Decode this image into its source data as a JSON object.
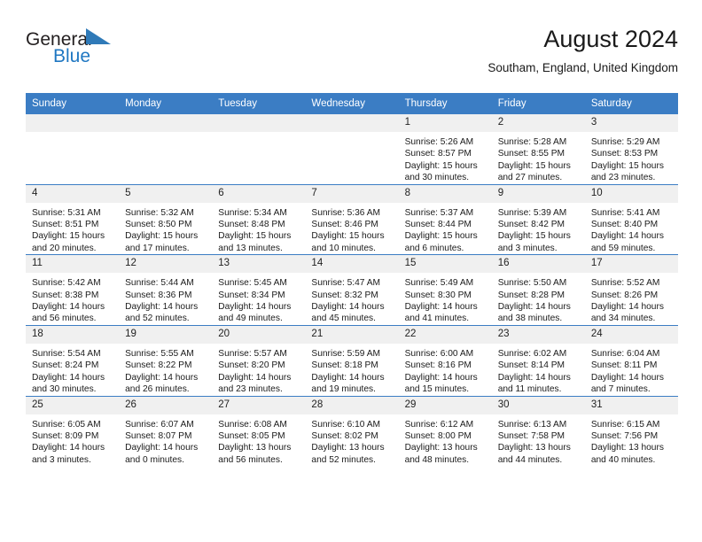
{
  "brand": {
    "name_part1": "General",
    "name_part2": "Blue",
    "triangle_color": "#2f7ab8",
    "text_color": "#231f20",
    "blue_color": "#1f77c2"
  },
  "header": {
    "title": "August 2024",
    "subtitle": "Southam, England, United Kingdom"
  },
  "theme": {
    "header_bg": "#3b7dc4",
    "header_text": "#ffffff",
    "daynum_bg": "#f0f0f0",
    "row_divider": "#3b7dc4",
    "body_text": "#1a1a1a"
  },
  "weekdays": [
    "Sunday",
    "Monday",
    "Tuesday",
    "Wednesday",
    "Thursday",
    "Friday",
    "Saturday"
  ],
  "labels": {
    "sunrise": "Sunrise:",
    "sunset": "Sunset:",
    "daylight": "Daylight:"
  },
  "weeks": [
    [
      {
        "day": "",
        "sunrise": "",
        "sunset": "",
        "daylight": ""
      },
      {
        "day": "",
        "sunrise": "",
        "sunset": "",
        "daylight": ""
      },
      {
        "day": "",
        "sunrise": "",
        "sunset": "",
        "daylight": ""
      },
      {
        "day": "",
        "sunrise": "",
        "sunset": "",
        "daylight": ""
      },
      {
        "day": "1",
        "sunrise": "Sunrise: 5:26 AM",
        "sunset": "Sunset: 8:57 PM",
        "daylight": "Daylight: 15 hours and 30 minutes."
      },
      {
        "day": "2",
        "sunrise": "Sunrise: 5:28 AM",
        "sunset": "Sunset: 8:55 PM",
        "daylight": "Daylight: 15 hours and 27 minutes."
      },
      {
        "day": "3",
        "sunrise": "Sunrise: 5:29 AM",
        "sunset": "Sunset: 8:53 PM",
        "daylight": "Daylight: 15 hours and 23 minutes."
      }
    ],
    [
      {
        "day": "4",
        "sunrise": "Sunrise: 5:31 AM",
        "sunset": "Sunset: 8:51 PM",
        "daylight": "Daylight: 15 hours and 20 minutes."
      },
      {
        "day": "5",
        "sunrise": "Sunrise: 5:32 AM",
        "sunset": "Sunset: 8:50 PM",
        "daylight": "Daylight: 15 hours and 17 minutes."
      },
      {
        "day": "6",
        "sunrise": "Sunrise: 5:34 AM",
        "sunset": "Sunset: 8:48 PM",
        "daylight": "Daylight: 15 hours and 13 minutes."
      },
      {
        "day": "7",
        "sunrise": "Sunrise: 5:36 AM",
        "sunset": "Sunset: 8:46 PM",
        "daylight": "Daylight: 15 hours and 10 minutes."
      },
      {
        "day": "8",
        "sunrise": "Sunrise: 5:37 AM",
        "sunset": "Sunset: 8:44 PM",
        "daylight": "Daylight: 15 hours and 6 minutes."
      },
      {
        "day": "9",
        "sunrise": "Sunrise: 5:39 AM",
        "sunset": "Sunset: 8:42 PM",
        "daylight": "Daylight: 15 hours and 3 minutes."
      },
      {
        "day": "10",
        "sunrise": "Sunrise: 5:41 AM",
        "sunset": "Sunset: 8:40 PM",
        "daylight": "Daylight: 14 hours and 59 minutes."
      }
    ],
    [
      {
        "day": "11",
        "sunrise": "Sunrise: 5:42 AM",
        "sunset": "Sunset: 8:38 PM",
        "daylight": "Daylight: 14 hours and 56 minutes."
      },
      {
        "day": "12",
        "sunrise": "Sunrise: 5:44 AM",
        "sunset": "Sunset: 8:36 PM",
        "daylight": "Daylight: 14 hours and 52 minutes."
      },
      {
        "day": "13",
        "sunrise": "Sunrise: 5:45 AM",
        "sunset": "Sunset: 8:34 PM",
        "daylight": "Daylight: 14 hours and 49 minutes."
      },
      {
        "day": "14",
        "sunrise": "Sunrise: 5:47 AM",
        "sunset": "Sunset: 8:32 PM",
        "daylight": "Daylight: 14 hours and 45 minutes."
      },
      {
        "day": "15",
        "sunrise": "Sunrise: 5:49 AM",
        "sunset": "Sunset: 8:30 PM",
        "daylight": "Daylight: 14 hours and 41 minutes."
      },
      {
        "day": "16",
        "sunrise": "Sunrise: 5:50 AM",
        "sunset": "Sunset: 8:28 PM",
        "daylight": "Daylight: 14 hours and 38 minutes."
      },
      {
        "day": "17",
        "sunrise": "Sunrise: 5:52 AM",
        "sunset": "Sunset: 8:26 PM",
        "daylight": "Daylight: 14 hours and 34 minutes."
      }
    ],
    [
      {
        "day": "18",
        "sunrise": "Sunrise: 5:54 AM",
        "sunset": "Sunset: 8:24 PM",
        "daylight": "Daylight: 14 hours and 30 minutes."
      },
      {
        "day": "19",
        "sunrise": "Sunrise: 5:55 AM",
        "sunset": "Sunset: 8:22 PM",
        "daylight": "Daylight: 14 hours and 26 minutes."
      },
      {
        "day": "20",
        "sunrise": "Sunrise: 5:57 AM",
        "sunset": "Sunset: 8:20 PM",
        "daylight": "Daylight: 14 hours and 23 minutes."
      },
      {
        "day": "21",
        "sunrise": "Sunrise: 5:59 AM",
        "sunset": "Sunset: 8:18 PM",
        "daylight": "Daylight: 14 hours and 19 minutes."
      },
      {
        "day": "22",
        "sunrise": "Sunrise: 6:00 AM",
        "sunset": "Sunset: 8:16 PM",
        "daylight": "Daylight: 14 hours and 15 minutes."
      },
      {
        "day": "23",
        "sunrise": "Sunrise: 6:02 AM",
        "sunset": "Sunset: 8:14 PM",
        "daylight": "Daylight: 14 hours and 11 minutes."
      },
      {
        "day": "24",
        "sunrise": "Sunrise: 6:04 AM",
        "sunset": "Sunset: 8:11 PM",
        "daylight": "Daylight: 14 hours and 7 minutes."
      }
    ],
    [
      {
        "day": "25",
        "sunrise": "Sunrise: 6:05 AM",
        "sunset": "Sunset: 8:09 PM",
        "daylight": "Daylight: 14 hours and 3 minutes."
      },
      {
        "day": "26",
        "sunrise": "Sunrise: 6:07 AM",
        "sunset": "Sunset: 8:07 PM",
        "daylight": "Daylight: 14 hours and 0 minutes."
      },
      {
        "day": "27",
        "sunrise": "Sunrise: 6:08 AM",
        "sunset": "Sunset: 8:05 PM",
        "daylight": "Daylight: 13 hours and 56 minutes."
      },
      {
        "day": "28",
        "sunrise": "Sunrise: 6:10 AM",
        "sunset": "Sunset: 8:02 PM",
        "daylight": "Daylight: 13 hours and 52 minutes."
      },
      {
        "day": "29",
        "sunrise": "Sunrise: 6:12 AM",
        "sunset": "Sunset: 8:00 PM",
        "daylight": "Daylight: 13 hours and 48 minutes."
      },
      {
        "day": "30",
        "sunrise": "Sunrise: 6:13 AM",
        "sunset": "Sunset: 7:58 PM",
        "daylight": "Daylight: 13 hours and 44 minutes."
      },
      {
        "day": "31",
        "sunrise": "Sunrise: 6:15 AM",
        "sunset": "Sunset: 7:56 PM",
        "daylight": "Daylight: 13 hours and 40 minutes."
      }
    ]
  ]
}
